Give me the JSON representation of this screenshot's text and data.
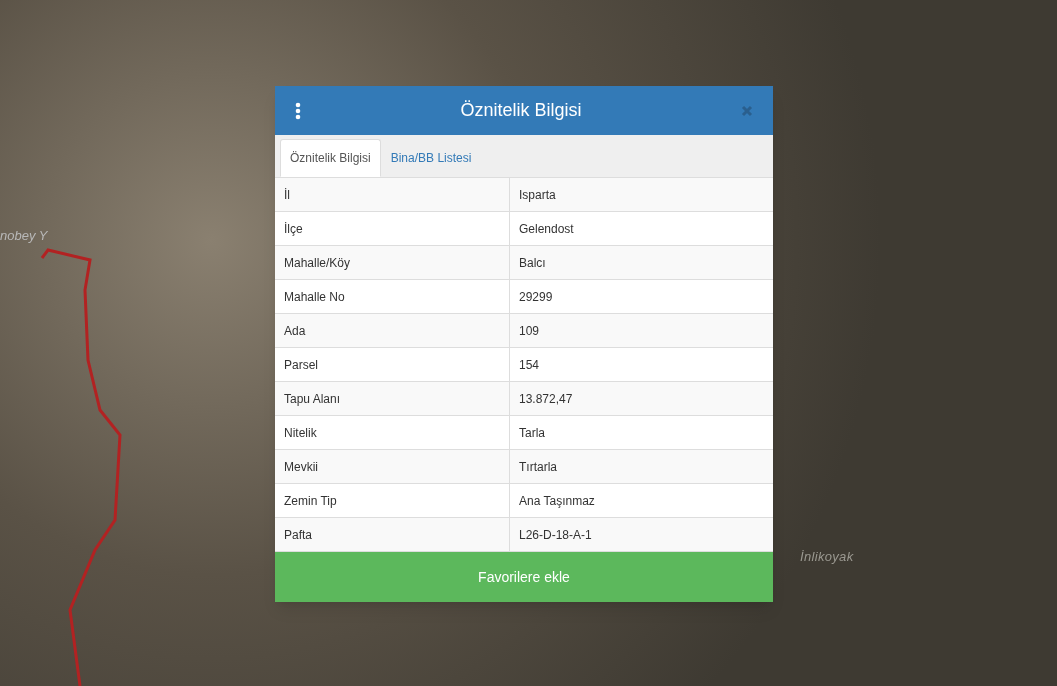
{
  "map": {
    "labels": [
      {
        "text": "İnlikoyak"
      },
      {
        "text": "nobey Y"
      }
    ]
  },
  "dialog": {
    "title": "Öznitelik Bilgisi",
    "tabs": [
      {
        "label": "Öznitelik Bilgisi",
        "selected": true
      },
      {
        "label": "Bina/BB Listesi",
        "selected": false
      }
    ],
    "rows": [
      {
        "key": "İl",
        "value": "Isparta"
      },
      {
        "key": "İlçe",
        "value": "Gelendost"
      },
      {
        "key": "Mahalle/Köy",
        "value": "Balcı"
      },
      {
        "key": "Mahalle No",
        "value": "29299"
      },
      {
        "key": "Ada",
        "value": "109"
      },
      {
        "key": "Parsel",
        "value": "154"
      },
      {
        "key": "Tapu Alanı",
        "value": "13.872,47"
      },
      {
        "key": "Nitelik",
        "value": "Tarla"
      },
      {
        "key": "Mevkii",
        "value": "Tırtarla"
      },
      {
        "key": "Zemin Tip",
        "value": "Ana Taşınmaz"
      },
      {
        "key": "Pafta",
        "value": "L26-D-18-A-1"
      }
    ],
    "button": "Favorilere ekle"
  }
}
